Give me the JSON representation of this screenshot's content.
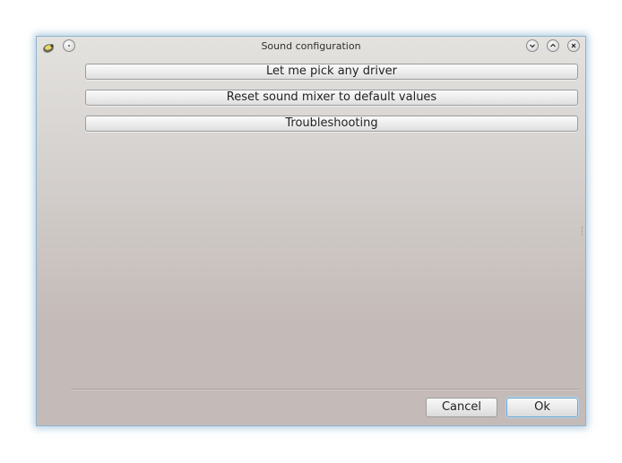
{
  "window": {
    "title": "Sound configuration",
    "controls": {
      "app_icon": "sound-app-icon",
      "sticky": "pin-icon",
      "minimize": "chevron-down-icon",
      "maximize": "chevron-up-icon",
      "close": "close-icon"
    }
  },
  "actions": {
    "pick_driver_label": "Let me pick any driver",
    "reset_mixer_label": "Reset sound mixer to default values",
    "troubleshooting_label": "Troubleshooting"
  },
  "footer": {
    "cancel_label": "Cancel",
    "ok_label": "Ok"
  },
  "colors": {
    "window_border": "#8fb5cc",
    "ok_focus": "#6fa6cf"
  }
}
